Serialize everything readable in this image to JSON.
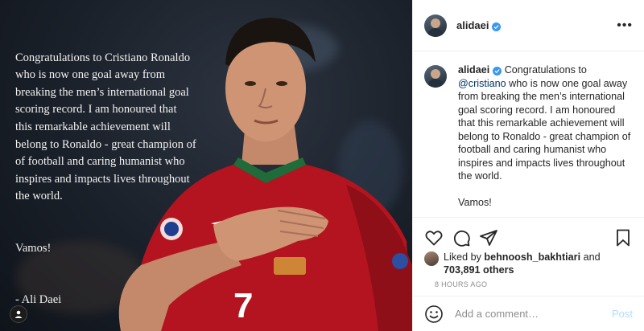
{
  "photo": {
    "quote_paragraphs": [
      "Congratulations to Cristiano Ronaldo\nwho is now one goal away from\nbreaking the men’s international goal\nscoring record. I am honoured that\nthis remarkable achievement will\nbelong to Ronaldo - great champion of\n of football and caring humanist who\ninspires and impacts lives throughout\nthe world.",
      "Vamos!",
      " - Ali Daei"
    ],
    "jersey_number": "7"
  },
  "header": {
    "username": "alidaei",
    "verified_icon": "verified-badge-icon",
    "more_icon": "more-options-icon"
  },
  "caption": {
    "username": "alidaei",
    "before_mention": " Congratulations to ",
    "mention": "@cristiano",
    "after_mention": " who is now one goal away from breaking the men’s international goal scoring record. I am honoured that this remarkable achievement will belong to Ronaldo - great champion of football and caring humanist who inspires and impacts lives throughout the world.",
    "closing": "Vamos!"
  },
  "likes": {
    "prefix": "Liked by ",
    "user": "behnoosh_bakhtiari",
    "and": " and",
    "count": "703,891 others"
  },
  "timestamp": "8 HOURS AGO",
  "comment_box": {
    "placeholder": "Add a comment…",
    "post_label": "Post"
  },
  "colors": {
    "accent": "#3897f0",
    "post_disabled": "#b3dbff",
    "mention": "#00376b",
    "jersey_red": "#b3141f"
  }
}
